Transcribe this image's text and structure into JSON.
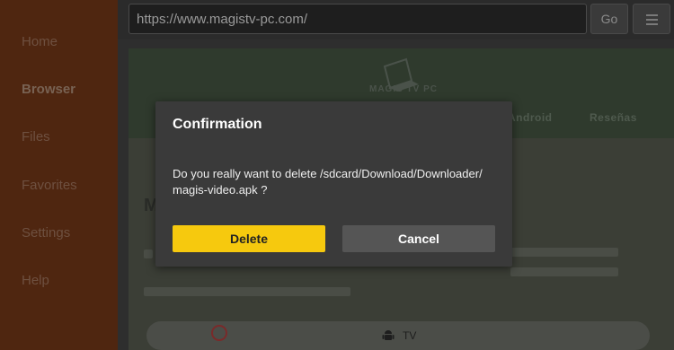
{
  "sidebar": {
    "items": [
      {
        "label": "Home"
      },
      {
        "label": "Browser"
      },
      {
        "label": "Files"
      },
      {
        "label": "Favorites"
      },
      {
        "label": "Settings"
      },
      {
        "label": "Help"
      }
    ]
  },
  "toolbar": {
    "url": "https://www.magistv-pc.com/",
    "go_label": "Go",
    "menu_icon": "hamburger-icon"
  },
  "webpage": {
    "logo_text": "MAGIS TV PC",
    "nav": [
      "Android",
      "Reseñas"
    ],
    "heading": "M",
    "pill_label": "TV"
  },
  "dialog": {
    "title": "Confirmation",
    "message": "Do you really want to delete /sdcard/Download/Downloader/ magis-video.apk ?",
    "delete_label": "Delete",
    "cancel_label": "Cancel"
  },
  "colors": {
    "sidebar_bg": "#4f2610",
    "accent_yellow": "#f6c90e",
    "dialog_bg": "#3a3a3a",
    "cancel_bg": "#555555"
  }
}
